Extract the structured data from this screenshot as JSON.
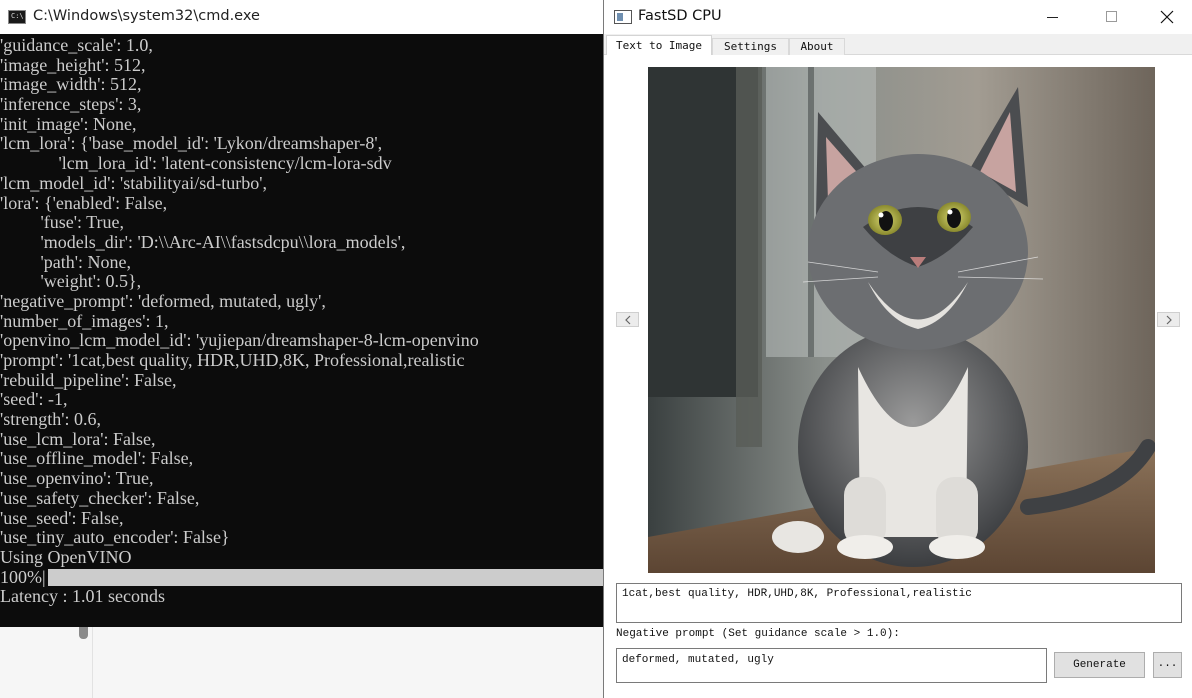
{
  "cmd": {
    "title": "C:\\Windows\\system32\\cmd.exe",
    "icon": "cmd-icon",
    "lines": [
      "'guidance_scale': 1.0,",
      "'image_height': 512,",
      "'image_width': 512,",
      "'inference_steps': 3,",
      "'init_image': None,",
      "'lcm_lora': {'base_model_id': 'Lykon/dreamshaper-8',",
      "             'lcm_lora_id': 'latent-consistency/lcm-lora-sdv",
      "'lcm_model_id': 'stabilityai/sd-turbo',",
      "'lora': {'enabled': False,",
      "         'fuse': True,",
      "         'models_dir': 'D:\\\\Arc-AI\\\\fastsdcpu\\\\lora_models',",
      "         'path': None,",
      "         'weight': 0.5},",
      "'negative_prompt': 'deformed, mutated, ugly',",
      "'number_of_images': 1,",
      "'openvino_lcm_model_id': 'yujiepan/dreamshaper-8-lcm-openvino",
      "'prompt': '1cat,best quality, HDR,UHD,8K, Professional,realistic",
      "'rebuild_pipeline': False,",
      "'seed': -1,",
      "'strength': 0.6,",
      "'use_lcm_lora': False,",
      "'use_offline_model': False,",
      "'use_openvino': True,",
      "'use_safety_checker': False,",
      "'use_seed': False,",
      "'use_tiny_auto_encoder': False}",
      "Using OpenVINO"
    ],
    "progress_label": "100%|",
    "progress": 1.0,
    "latency_line": "Latency : 1.01 seconds"
  },
  "app": {
    "title": "FastSD CPU",
    "icon": "window-icon",
    "window_controls": {
      "minimize": "minimize-icon",
      "maximize": "maximize-icon",
      "close": "close-icon"
    },
    "tabs": [
      {
        "label": "Text to Image",
        "active": true
      },
      {
        "label": "Settings",
        "active": false
      },
      {
        "label": "About",
        "active": false
      }
    ],
    "image_alt": "generated cat image",
    "prev_icon": "chevron-left-icon",
    "next_icon": "chevron-right-icon",
    "prompt": "1cat,best quality, HDR,UHD,8K, Professional,realistic",
    "negative_prompt_label": "Negative prompt (Set guidance scale > 1.0):",
    "negative_prompt": "deformed, mutated, ugly",
    "generate_label": "Generate",
    "more_label": "..."
  }
}
